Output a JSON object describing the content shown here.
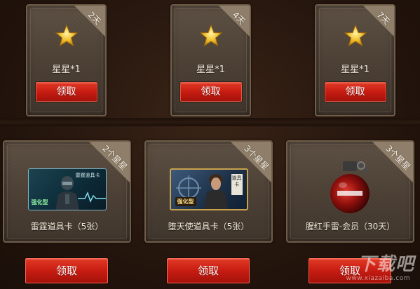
{
  "top_rewards": [
    {
      "ribbon": "2天",
      "name": "星星*1",
      "button": "领取"
    },
    {
      "ribbon": "4天",
      "name": "星星*1",
      "button": "领取"
    },
    {
      "ribbon": "7天",
      "name": "星星*1",
      "button": "领取"
    }
  ],
  "bottom_rewards": [
    {
      "ribbon": "2个星星",
      "name": "雷霆道具卡（5张）",
      "button": "领取",
      "image_title": "雷霆道具卡",
      "image_badge": "强化型"
    },
    {
      "ribbon": "3个星星",
      "name": "堕天使道具卡（5张）",
      "button": "领取",
      "image_badge": "强化型",
      "image_tag": "道具卡"
    },
    {
      "ribbon": "3个星星",
      "name": "腥红手雷-会员（30天）",
      "button": "领取"
    }
  ],
  "watermark": {
    "text": "下载吧",
    "url": "www.xiazaiba.com"
  },
  "colors": {
    "button_red": "#c61c12",
    "star_gold": "#f2c230",
    "panel": "#4b3f34",
    "ribbon": "#8e7e6a"
  },
  "icons": {
    "star": "star-icon",
    "grenade": "grenade-icon"
  }
}
